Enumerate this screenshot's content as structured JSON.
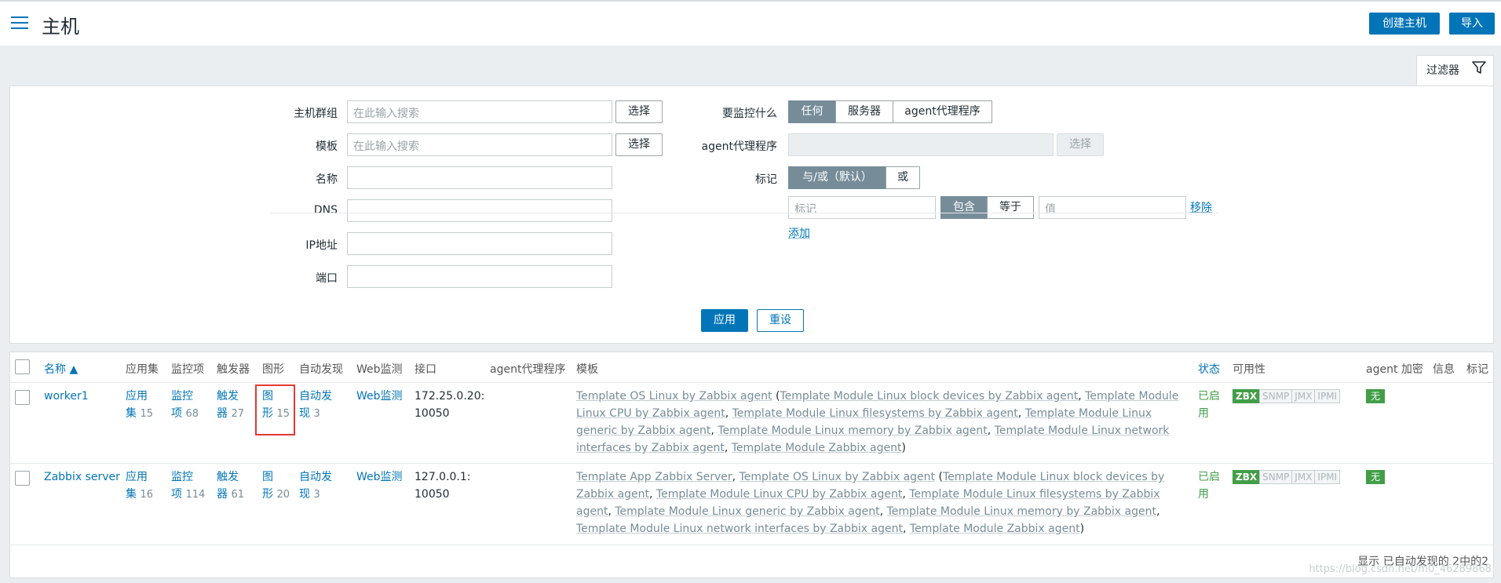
{
  "header": {
    "title": "主机",
    "create_host": "创建主机",
    "import": "导入"
  },
  "filter": {
    "tab_label": "过滤器",
    "host_groups_label": "主机群组",
    "host_groups_placeholder": "在此输入搜索",
    "templates_label": "模板",
    "templates_placeholder": "在此输入搜索",
    "select_label": "选择",
    "name_label": "名称",
    "dns_label": "DNS",
    "ip_label": "IP地址",
    "port_label": "端口",
    "monitored_by_label": "要监控什么",
    "monitored_by_options": [
      "任何",
      "服务器",
      "agent代理程序"
    ],
    "proxy_label": "agent代理程序",
    "proxy_select": "选择",
    "tags_label": "标记",
    "tags_mode": [
      "与/或（默认）",
      "或"
    ],
    "tag_placeholder": "标记",
    "tag_operators": [
      "包含",
      "等于"
    ],
    "value_placeholder": "值",
    "remove_label": "移除",
    "add_label": "添加",
    "apply_button": "应用",
    "reset_button": "重设"
  },
  "table": {
    "columns": [
      "名称 ▲",
      "应用集",
      "监控项",
      "触发器",
      "图形",
      "自动发现",
      "Web监测",
      "接口",
      "agent代理程序",
      "模板",
      "状态",
      "可用性",
      "agent 加密",
      "信息",
      "标记"
    ],
    "rows": [
      {
        "name": "worker1",
        "applications": [
          "应用",
          "集",
          "15"
        ],
        "items": [
          "监控",
          "项",
          "68"
        ],
        "triggers": [
          "触发",
          "器",
          "27"
        ],
        "graphs": [
          "图",
          "形",
          "15"
        ],
        "discovery": [
          "自动发",
          "现",
          "3"
        ],
        "web": "Web监测",
        "interface": [
          "172.25.0.20:",
          "10050"
        ],
        "templates": [
          {
            "t": "Template OS Linux by Zabbix agent",
            "link": true
          },
          {
            "t": " (",
            "link": false
          },
          {
            "t": "Template Module Linux block devices by Zabbix agent",
            "link": true
          },
          {
            "t": ", ",
            "link": false
          },
          {
            "t": "Template Module Linux CPU by Zabbix agent",
            "link": true
          },
          {
            "t": ", ",
            "link": false
          },
          {
            "t": "Template Module Linux filesystems by Zabbix agent",
            "link": true
          },
          {
            "t": ", ",
            "link": false
          },
          {
            "t": "Template Module Linux generic by Zabbix agent",
            "link": true
          },
          {
            "t": ", ",
            "link": false
          },
          {
            "t": "Template Module Linux memory by Zabbix agent",
            "link": true
          },
          {
            "t": ", ",
            "link": false
          },
          {
            "t": "Template Module Linux network interfaces by Zabbix agent",
            "link": true
          },
          {
            "t": ", ",
            "link": false
          },
          {
            "t": "Template Module Zabbix agent",
            "link": true
          },
          {
            "t": ")",
            "link": false
          }
        ],
        "status": [
          "已启",
          "用"
        ],
        "availability": [
          "ZBX",
          "SNMP",
          "JMX",
          "IPMI"
        ],
        "encryption": "无"
      },
      {
        "name": "Zabbix server",
        "applications": [
          "应用",
          "集",
          "16"
        ],
        "items": [
          "监控",
          "项",
          "114"
        ],
        "triggers": [
          "触发",
          "器",
          "61"
        ],
        "graphs": [
          "图",
          "形",
          "20"
        ],
        "discovery": [
          "自动发",
          "现",
          "3"
        ],
        "web": "Web监测",
        "interface": [
          "127.0.0.1:",
          "10050"
        ],
        "templates": [
          {
            "t": "Template App Zabbix Server",
            "link": true
          },
          {
            "t": ", ",
            "link": false
          },
          {
            "t": "Template OS Linux by Zabbix agent",
            "link": true
          },
          {
            "t": " (",
            "link": false
          },
          {
            "t": "Template Module Linux block devices by Zabbix agent",
            "link": true
          },
          {
            "t": ", ",
            "link": false
          },
          {
            "t": "Template Module Linux CPU by Zabbix agent",
            "link": true
          },
          {
            "t": ", ",
            "link": false
          },
          {
            "t": "Template Module Linux filesystems by Zabbix agent",
            "link": true
          },
          {
            "t": ", ",
            "link": false
          },
          {
            "t": "Template Module Linux generic by Zabbix agent",
            "link": true
          },
          {
            "t": ", ",
            "link": false
          },
          {
            "t": "Template Module Linux memory by Zabbix agent",
            "link": true
          },
          {
            "t": ", ",
            "link": false
          },
          {
            "t": "Template Module Linux network interfaces by Zabbix agent",
            "link": true
          },
          {
            "t": ", ",
            "link": false
          },
          {
            "t": "Template Module Zabbix agent",
            "link": true
          },
          {
            "t": ")",
            "link": false
          }
        ],
        "status": [
          "已启",
          "用"
        ],
        "availability": [
          "ZBX",
          "SNMP",
          "JMX",
          "IPMI"
        ],
        "encryption": "无"
      }
    ],
    "footer": "显示 已自动发现的 2中的2",
    "watermark": "https://blog.csdn.net/m0_46289868"
  },
  "colors": {
    "accent": "#0275b8",
    "active_segment": "#768d99",
    "enabled_green": "#429e47",
    "highlight_box": "#e53935"
  }
}
